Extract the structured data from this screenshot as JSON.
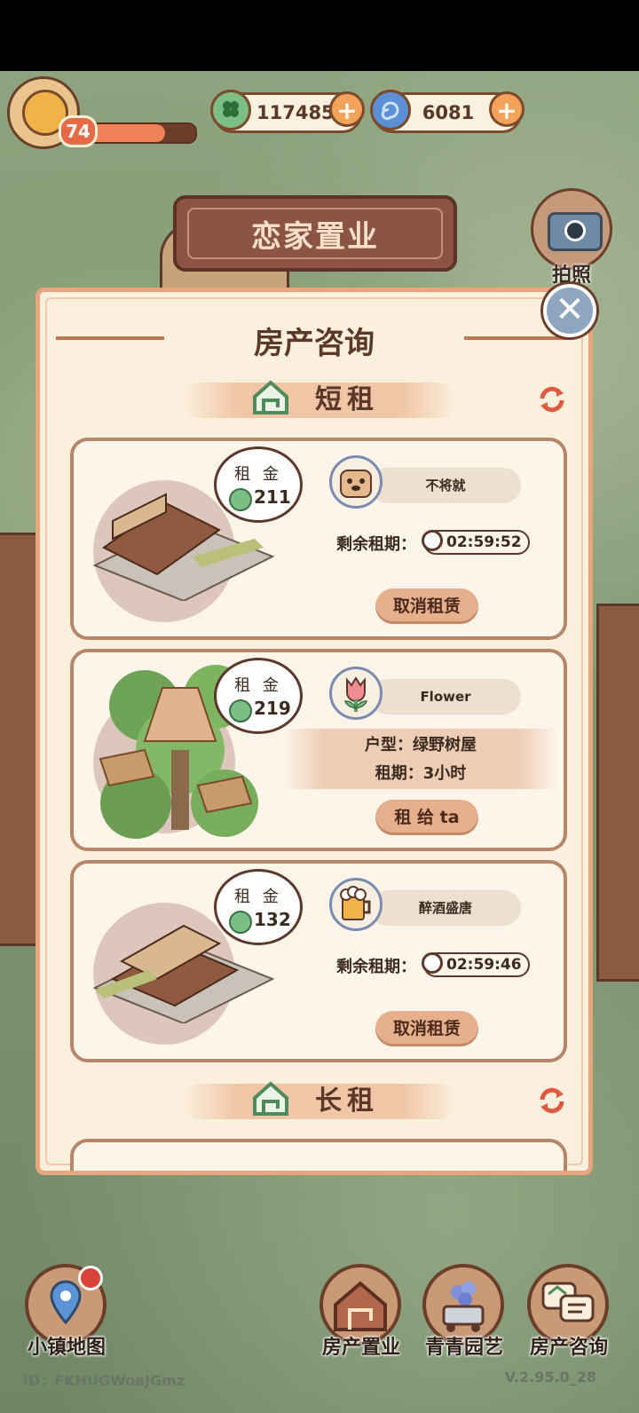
{
  "player": {
    "level": "74",
    "xp_fraction": 0.72
  },
  "currencies": [
    {
      "name": "clover-coin",
      "value": "117485",
      "color": "#7cbf85"
    },
    {
      "name": "blue-swirl-gem",
      "value": "6081",
      "color": "#5b8fd6"
    }
  ],
  "banner": {
    "title": "恋家置业"
  },
  "camera": {
    "label": "拍照"
  },
  "panel": {
    "title": "房产咨询",
    "short_term": {
      "label": "短租"
    },
    "long_term": {
      "label": "长租"
    },
    "cards": [
      {
        "rent_label": "租 金",
        "rent_value": "211",
        "tenant_name": "不将就",
        "remaining_label": "剩余租期：",
        "timer": "02:59:52",
        "action": "取消租赁"
      },
      {
        "rent_label": "租 金",
        "rent_value": "219",
        "tenant_name": "Flower",
        "type_line": "户型：绿野树屋",
        "term_line": "租期：3小时",
        "action": "租 给 ta"
      },
      {
        "rent_label": "租 金",
        "rent_value": "132",
        "tenant_name": "醉酒盛唐",
        "remaining_label": "剩余租期：",
        "timer": "02:59:46",
        "action": "取消租赁"
      }
    ]
  },
  "nav": {
    "town_map": "小镇地图",
    "property_buy": "房产置业",
    "garden": "青青园艺",
    "property_consult": "房产咨询"
  },
  "footer": {
    "id": "ID：FKHUGWoaJGmz",
    "version": "V.2.95.0_28"
  }
}
